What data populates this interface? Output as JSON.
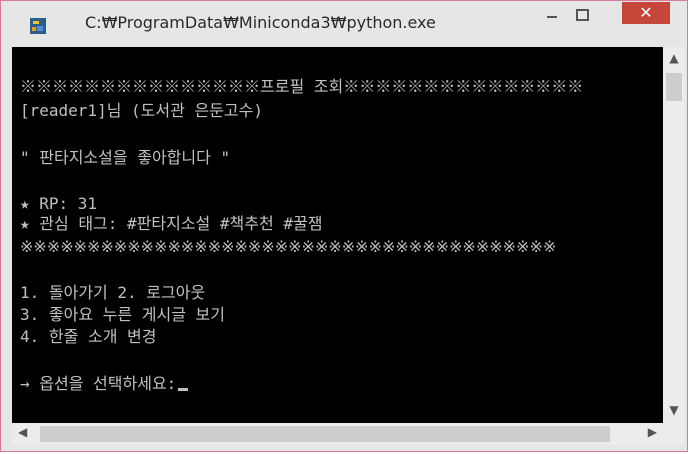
{
  "window": {
    "title": "C:₩ProgramData₩Miniconda3₩python.exe",
    "minimize_label": "—",
    "maximize_label": "□",
    "close_label": "✕"
  },
  "console": {
    "lines": [
      "※※※※※※※※※※※※※※※프로필 조회※※※※※※※※※※※※※※※",
      "[reader1]님 (도서관 은둔고수)",
      "\" 판타지소설을 좋아합니다 \"",
      "★ RP: 31",
      "★ 관심 태그: #판타지소설 #책추천 #꿀잼",
      "※※※※※※※※※※※※※※※※※※※※※※※※※※※※※※※※※※※※※※※※",
      "1. 돌아가기 2. 로그아웃",
      "3. 좋아요 누른 게시글 보기",
      "4. 한줄 소개 변경",
      "→ 옵션을 선택하세요:"
    ]
  }
}
